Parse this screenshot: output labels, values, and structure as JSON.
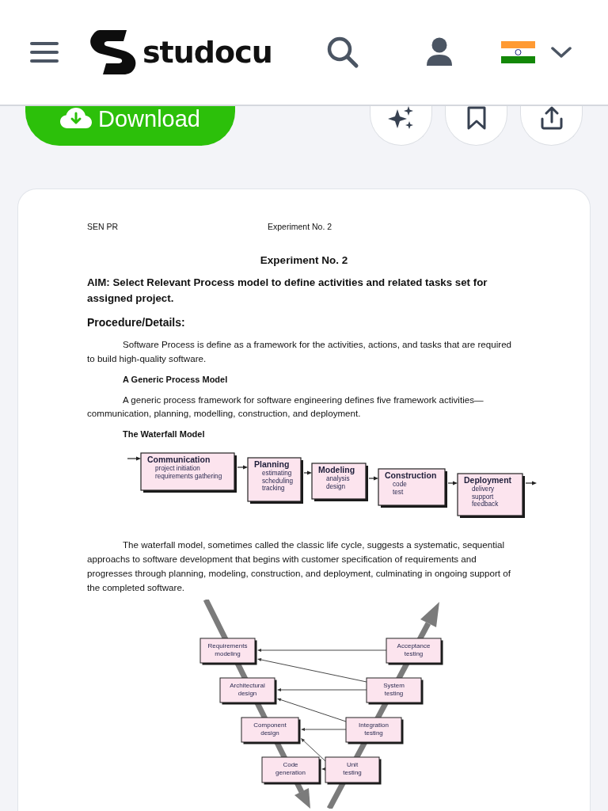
{
  "header": {
    "logo_text": "studocu"
  },
  "actions": {
    "download_button": "Download"
  },
  "document": {
    "running_header": [
      "SEN PR",
      "Experiment No. 2"
    ],
    "title": "Experiment No. 2",
    "aim": "AIM: Select Relevant Process model to define activities and related tasks set for assigned project.",
    "procedure_heading": "Procedure/Details:",
    "blocks": [
      {
        "kind": "paragraph",
        "text": "Software Process is define as a framework for the activities, actions, and tasks that are required to build high-quality software."
      },
      {
        "kind": "subheading",
        "text": "A Generic Process Model"
      },
      {
        "kind": "paragraph",
        "text": "A generic process framework for software engineering defines five framework activities—communication, planning, modelling, construction, and deployment."
      },
      {
        "kind": "subheading",
        "text": "The Waterfall Model"
      },
      {
        "kind": "waterfall",
        "stages": [
          {
            "title": "Communication",
            "tasks": [
              "project initiation",
              "requirements gathering"
            ]
          },
          {
            "title": "Planning",
            "tasks": [
              "estimating",
              "scheduling",
              "tracking"
            ]
          },
          {
            "title": "Modeling",
            "tasks": [
              "analysis",
              "design"
            ]
          },
          {
            "title": "Construction",
            "tasks": [
              "code",
              "test"
            ]
          },
          {
            "title": "Deployment",
            "tasks": [
              "delivery",
              "support",
              "feedback"
            ]
          }
        ]
      },
      {
        "kind": "paragraph",
        "text": "The waterfall model, sometimes called the classic life cycle, suggests a systematic, sequential approachs to software development that begins with customer specification of requirements and progresses through planning, modeling, construction, and deployment, culminating in ongoing support of the completed software."
      },
      {
        "kind": "vmodel",
        "left": [
          {
            "lines": [
              "Requirements",
              "modeling"
            ]
          },
          {
            "lines": [
              "Architectural",
              "design"
            ]
          },
          {
            "lines": [
              "Component",
              "design"
            ]
          },
          {
            "lines": [
              "Code",
              "generation"
            ]
          }
        ],
        "right": [
          {
            "lines": [
              "Acceptance",
              "testing"
            ]
          },
          {
            "lines": [
              "System",
              "testing"
            ]
          },
          {
            "lines": [
              "Integration",
              "testing"
            ]
          },
          {
            "lines": [
              "Unit",
              "testing"
            ]
          }
        ]
      }
    ]
  }
}
